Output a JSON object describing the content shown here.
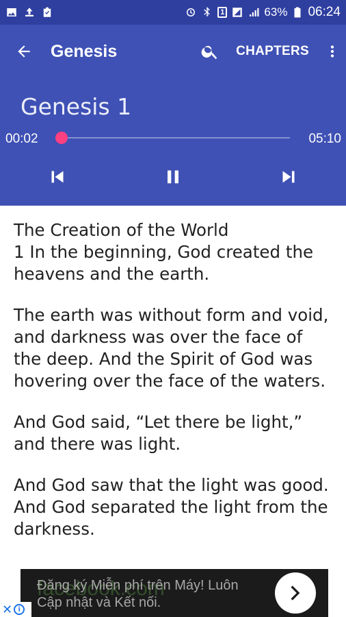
{
  "status_bar": {
    "battery": "63%",
    "time": "06:24",
    "sim": "1",
    "icons": [
      "gallery-icon",
      "upload-icon",
      "clipboard-icon",
      "alarm-icon",
      "bluetooth-icon",
      "sim-icon",
      "signal-icon",
      "signal-icon",
      "battery-icon"
    ]
  },
  "app_bar": {
    "title": "Genesis",
    "chapters_label": "CHAPTERS",
    "icons": [
      "back-arrow-icon",
      "search-icon",
      "more-vert-icon"
    ]
  },
  "player": {
    "chapter_title": "Genesis 1",
    "current_time": "00:02",
    "total_time": "05:10",
    "progress_fraction": 0.006,
    "accent_color": "#ff4081",
    "icons": [
      "skip-previous-icon",
      "pause-icon",
      "skip-next-icon"
    ]
  },
  "content": {
    "paragraphs": [
      "The Creation of the World\n1 In the beginning, God created the heavens and the earth.",
      "The earth was without form and void, and darkness was over the face of the deep. And the Spirit of God was hovering over the face of the waters.",
      "And God said, “Let there be light,” and there was light.",
      "And God saw that the light was good. And God separated the light from the darkness."
    ]
  },
  "ad": {
    "watermark": "facebook.com",
    "text_line1": "Đăng ký Miễn phí trên Máy! Luôn",
    "text_line2": "Cập nhật và Kết nối.",
    "icons": [
      "chevron-right-icon",
      "close-icon",
      "info-icon"
    ]
  },
  "colors": {
    "primary": "#3f51b5",
    "primary_dark": "#2f3fa0",
    "accent": "#ff4081"
  }
}
